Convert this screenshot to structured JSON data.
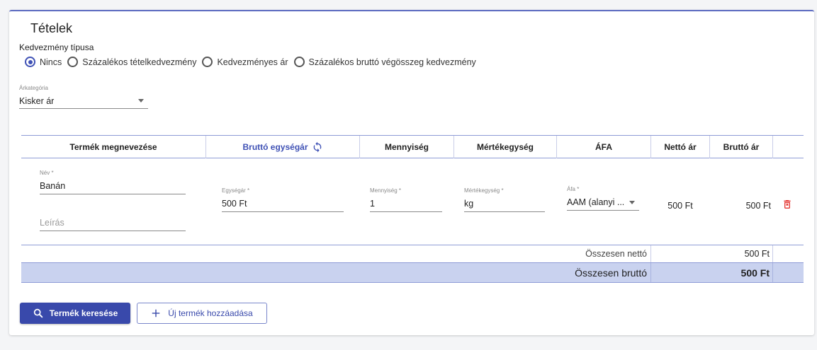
{
  "section": {
    "title": "Tételek"
  },
  "discount": {
    "label": "Kedvezmény típusa",
    "options": [
      "Nincs",
      "Százalékos tételkedvezmény",
      "Kedvezményes ár",
      "Százalékos bruttó végösszeg kedvezmény"
    ],
    "selected": "Nincs"
  },
  "price_category": {
    "label": "Árkategória",
    "value": "Kisker ár"
  },
  "table": {
    "headers": {
      "name": "Termék megnevezése",
      "unit_price": "Bruttó egységár",
      "quantity": "Mennyiség",
      "unit": "Mértékegység",
      "vat": "ÁFA",
      "net": "Nettó ár",
      "gross": "Bruttó ár"
    },
    "row": {
      "name_label": "Név *",
      "name_value": "Banán",
      "description_placeholder": "Leírás",
      "unit_price_label": "Egységár *",
      "unit_price_value": "500 Ft",
      "quantity_label": "Mennyiség *",
      "quantity_value": "1",
      "unit_label": "Mértékegység *",
      "unit_value": "kg",
      "vat_label": "Áfa *",
      "vat_value": "AAM (alanyi ...",
      "net": "500 Ft",
      "gross": "500 Ft"
    },
    "totals": {
      "net_label": "Összesen nettó",
      "net_value": "500 Ft",
      "gross_label": "Összesen bruttó",
      "gross_value": "500 Ft"
    }
  },
  "buttons": {
    "search_product": "Termék keresése",
    "add_product": "Új termék hozzáadása"
  },
  "colors": {
    "primary": "#3949ab",
    "total_bg": "#c9d2ef",
    "delete": "#e53935"
  }
}
